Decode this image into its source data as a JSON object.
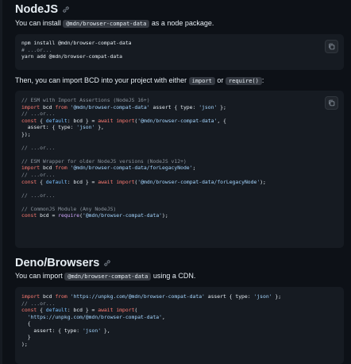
{
  "sections": {
    "nodejs": {
      "title": "NodeJS",
      "intro_before": "You can install ",
      "intro_code": "@mdn/browser-compat-data",
      "intro_after": " as a node package.",
      "import_text_before": "Then, you can import BCD into your project with either ",
      "import_code_1": "import",
      "import_text_mid": " or ",
      "import_code_2": "require()",
      "import_text_after": ":"
    },
    "deno": {
      "title": "Deno/Browsers",
      "intro_before": "You can import ",
      "intro_code": "@mdn/browser-compat-data",
      "intro_after": " using a CDN."
    }
  },
  "code_blocks": {
    "install": {
      "line1": "npm install @mdn/browser-compat-data",
      "line2": "# ...or...",
      "line3": "yarn add @mdn/browser-compat-data"
    },
    "nodejs": {
      "c1": "// ESM with Import Assertions (NodeJS 16+)",
      "l2a": "import",
      "l2b": " bcd ",
      "l2c": "from",
      "l2d": "'@mdn/browser-compat-data'",
      "l2e": " assert { type: ",
      "l2f": "'json'",
      "l2g": " };",
      "c3": "// ...or...",
      "l4a": "const",
      "l4b": " { ",
      "l4c": "default",
      "l4d": ": bcd } = ",
      "l4e": "await",
      "l4f": "import",
      "l4g": "(",
      "l4h": "'@mdn/browser-compat-data'",
      "l4i": ", {",
      "l5a": "  assert: { type: ",
      "l5b": "'json'",
      "l5c": " },",
      "l6": "});",
      "c8": "// ...or...",
      "c10": "// ESM Wrapper for older NodeJS versions (NodeJS v12+)",
      "l11a": "import",
      "l11b": " bcd ",
      "l11c": "from",
      "l11d": "'@mdn/browser-compat-data/forLegacyNode'",
      "l11e": ";",
      "c12": "// ...or...",
      "l13a": "const",
      "l13b": " { ",
      "l13c": "default",
      "l13d": ": bcd } = ",
      "l13e": "await",
      "l13f": "import",
      "l13g": "(",
      "l13h": "'@mdn/browser-compat-data/forLegacyNode'",
      "l13i": ");",
      "c15": "// ...or...",
      "c17": "// CommonJS Module (Any NodeJS)",
      "l18a": "const",
      "l18b": " bcd = ",
      "l18c": "require",
      "l18d": "(",
      "l18e": "'@mdn/browser-compat-data'",
      "l18f": ");"
    },
    "deno": {
      "l1a": "import",
      "l1b": " bcd ",
      "l1c": "from",
      "l1d": "'https://unpkg.com/@mdn/browser-compat-data'",
      "l1e": " assert { type: ",
      "l1f": "'json'",
      "l1g": " };",
      "c2": "// ...or...",
      "l3a": "const",
      "l3b": " { ",
      "l3c": "default",
      "l3d": ": bcd } = ",
      "l3e": "await",
      "l3f": "import",
      "l3g": "(",
      "l4": "  'https://unpkg.com/@mdn/browser-compat-data'",
      "l4b": ",",
      "l5": "  {",
      "l6a": "    assert: { type: ",
      "l6b": "'json'",
      "l6c": " },",
      "l7": "  }",
      "l8": ");"
    }
  },
  "icons": {
    "anchor": "link-icon",
    "copy": "copy-icon"
  }
}
